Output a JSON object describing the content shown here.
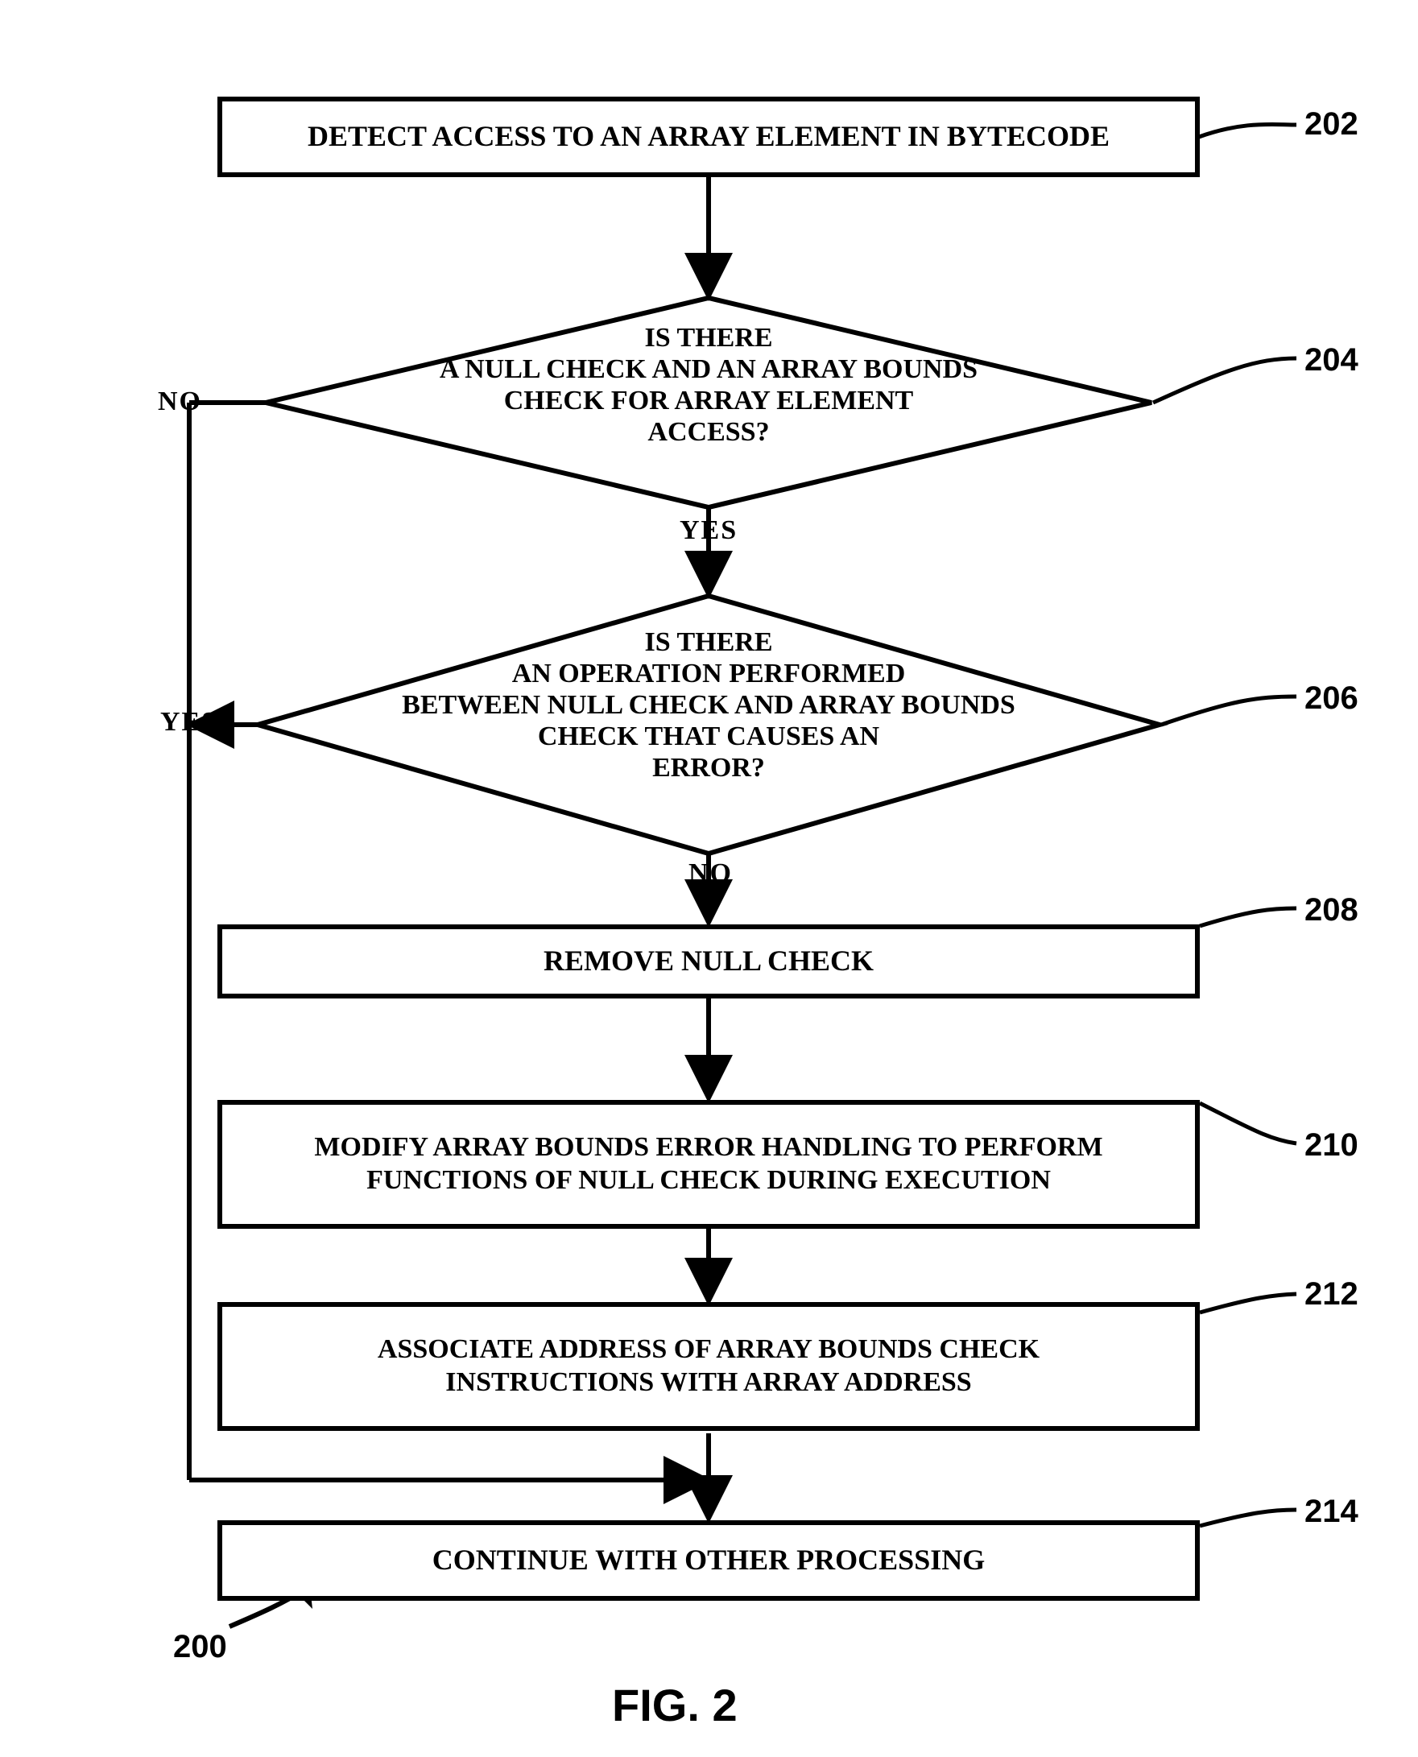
{
  "boxes": {
    "b202": "DETECT ACCESS TO AN ARRAY ELEMENT IN BYTECODE",
    "b208": "REMOVE NULL CHECK",
    "b210": "MODIFY ARRAY BOUNDS ERROR HANDLING TO PERFORM FUNCTIONS OF NULL CHECK DURING EXECUTION",
    "b212": "ASSOCIATE ADDRESS OF ARRAY BOUNDS CHECK INSTRUCTIONS WITH ARRAY ADDRESS",
    "b214": "CONTINUE WITH OTHER PROCESSING"
  },
  "diamonds": {
    "d204": "IS THERE\nA NULL CHECK AND AN ARRAY BOUNDS\nCHECK FOR ARRAY ELEMENT\nACCESS?",
    "d206": "IS THERE\nAN OPERATION PERFORMED\nBETWEEN NULL CHECK AND ARRAY BOUNDS\nCHECK THAT CAUSES AN\nERROR?"
  },
  "branch_labels": {
    "d204_left": "NO",
    "d204_down": "YES",
    "d206_left": "YES",
    "d206_down": "NO"
  },
  "refs": {
    "r202": "202",
    "r204": "204",
    "r206": "206",
    "r208": "208",
    "r210": "210",
    "r212": "212",
    "r214": "214",
    "r200": "200"
  },
  "figure": "FIG. 2"
}
